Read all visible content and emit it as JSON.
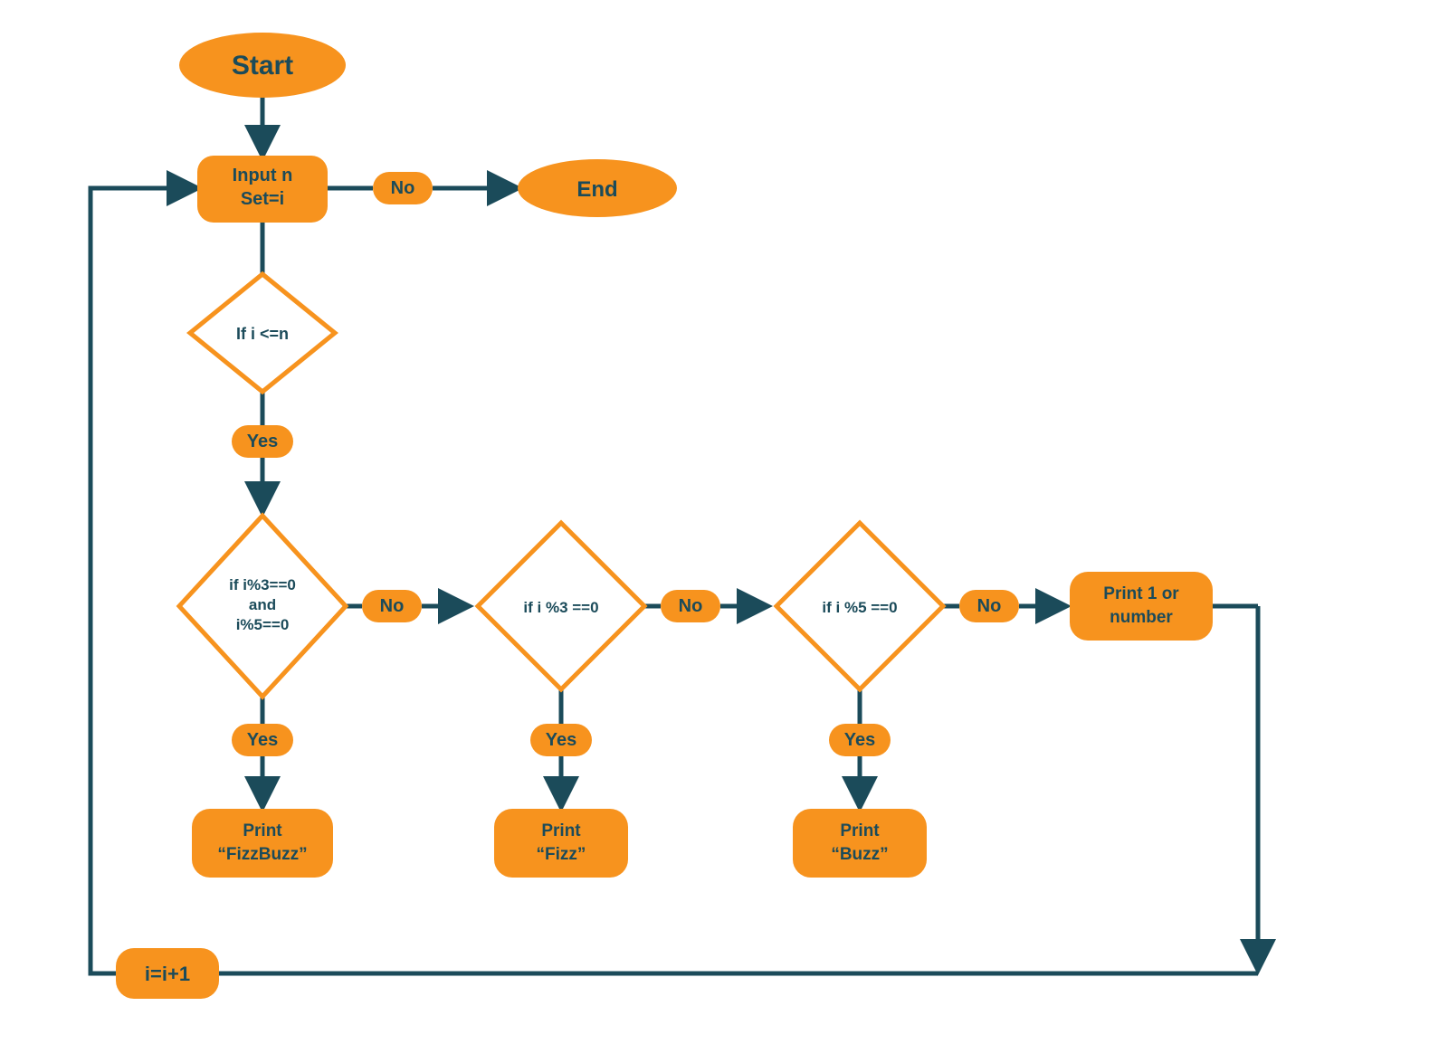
{
  "colors": {
    "orange": "#F7931E",
    "dark": "#1B4B5A",
    "white": "#FFFFFF"
  },
  "nodes": {
    "start": "Start",
    "input_l1": "Input n",
    "input_l2": "Set=i",
    "end": "End",
    "cond1": "If i <=n",
    "cond2_l1": "if i%3==0",
    "cond2_l2": "and",
    "cond2_l3": "i%5==0",
    "cond3": "if i %3 ==0",
    "cond4": "if i %5 ==0",
    "print1_l1": "Print",
    "print1_l2": "“FizzBuzz”",
    "print2_l1": "Print",
    "print2_l2": "“Fizz”",
    "print3_l1": "Print",
    "print3_l2": "“Buzz”",
    "print4_l1": "Print 1 or",
    "print4_l2": "number",
    "incr": "i=i+1"
  },
  "labels": {
    "no": "No",
    "yes": "Yes"
  }
}
